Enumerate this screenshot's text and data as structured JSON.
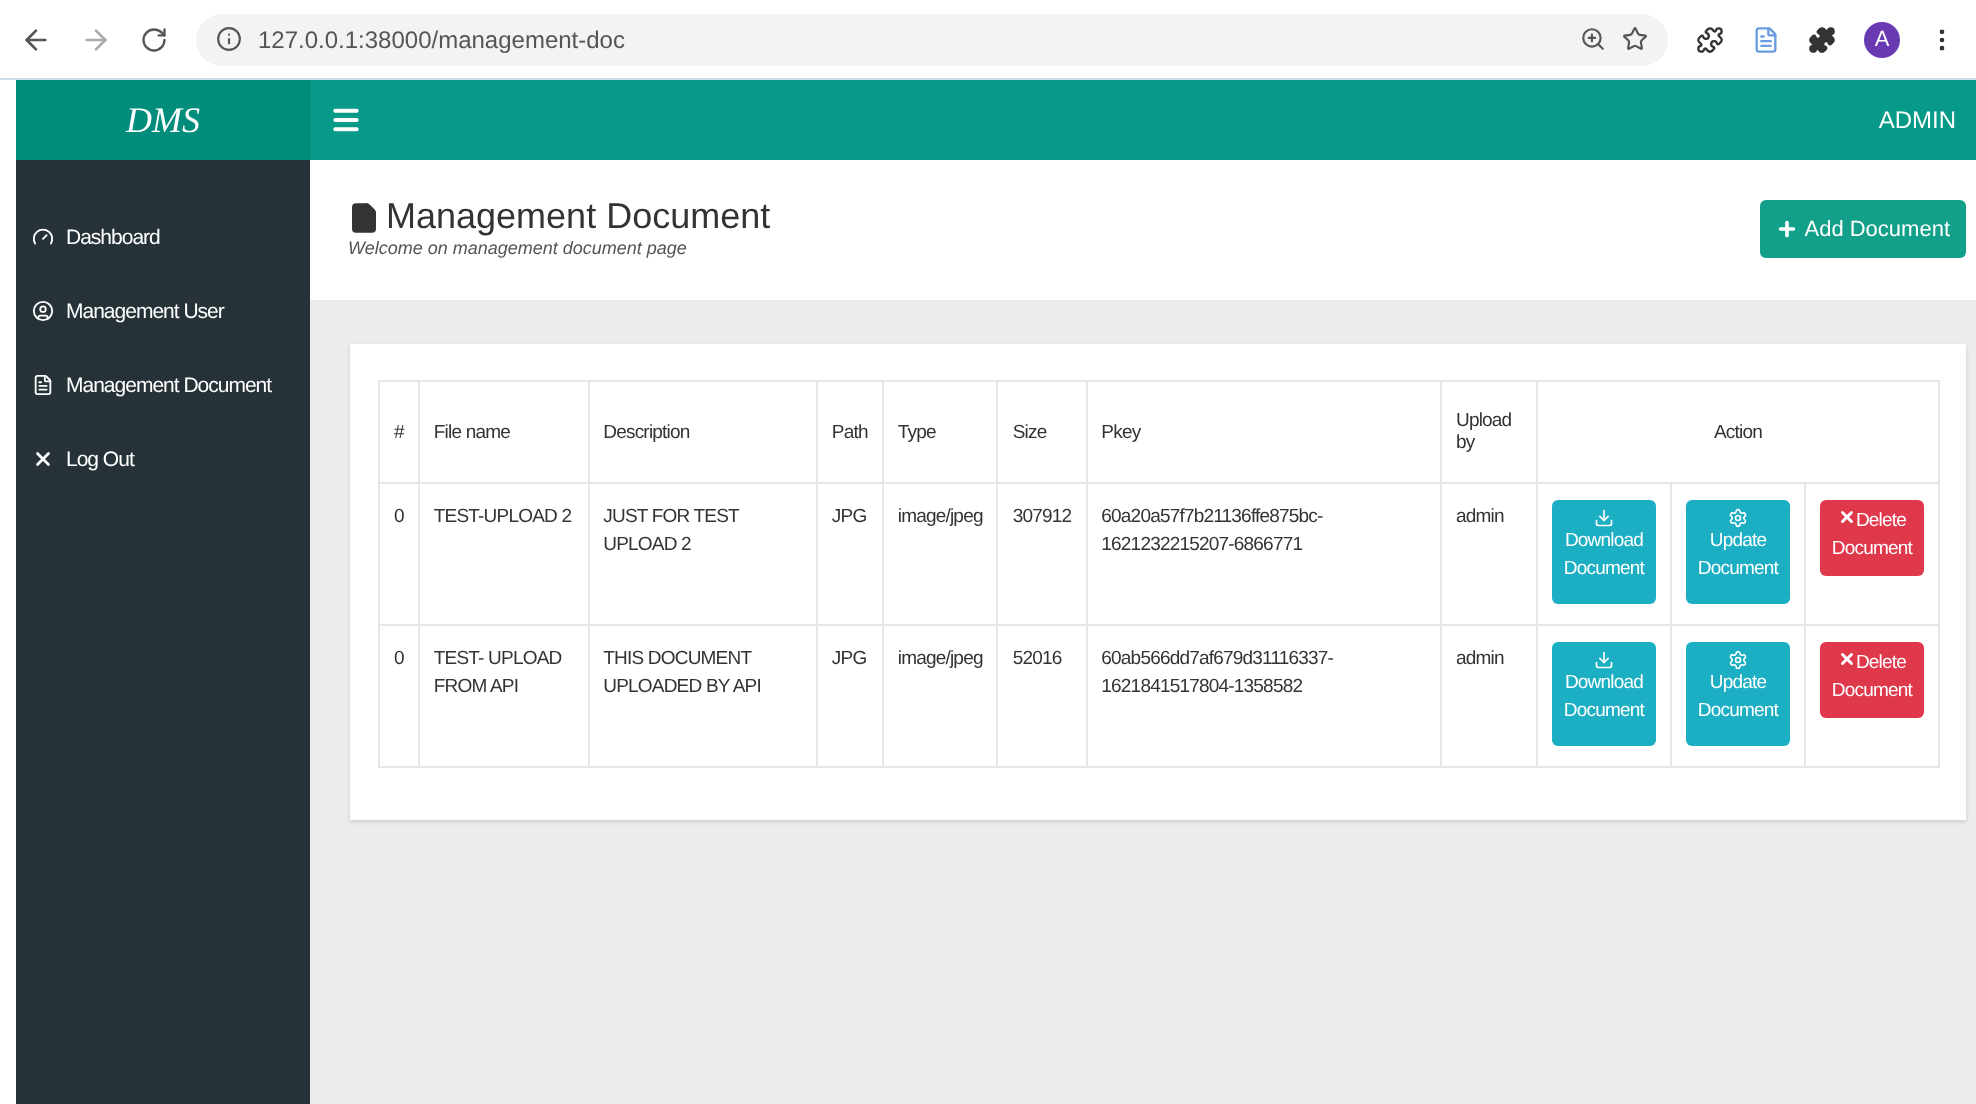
{
  "browser": {
    "url": "127.0.0.1:38000/management-doc",
    "profile_initial": "A"
  },
  "brand": "DMS",
  "topbar": {
    "user": "ADMIN"
  },
  "sidebar": {
    "items": [
      {
        "label": "Dashboard",
        "kind": "dashboard"
      },
      {
        "label": "Management User",
        "kind": "user"
      },
      {
        "label": "Management Document",
        "kind": "document"
      },
      {
        "label": "Log Out",
        "kind": "logout"
      }
    ]
  },
  "page": {
    "title": "Management Document",
    "subtitle": "Welcome on management document page",
    "add_button": "Add Document"
  },
  "table": {
    "columns": [
      "#",
      "File name",
      "Description",
      "Path",
      "Type",
      "Size",
      "Pkey",
      "Upload by",
      "Action"
    ],
    "rows": [
      {
        "cells": [
          "0",
          "TEST-UPLOAD 2",
          "JUST FOR TEST UPLOAD 2",
          "JPG",
          "image/jpeg",
          "307912",
          "60a20a57f7b21136ffe875bc-1621232215207-6866771",
          "admin"
        ],
        "actions": [
          {
            "kind": "download",
            "label": "Download Document"
          },
          {
            "kind": "update",
            "label": "Update Document"
          },
          {
            "kind": "delete",
            "label": "Delete Document"
          }
        ]
      },
      {
        "cells": [
          "0",
          "TEST- UPLOAD FROM API",
          "THIS DOCUMENT UPLOADED BY API",
          "JPG",
          "image/jpeg",
          "52016",
          "60ab566dd7af679d31116337-1621841517804-1358582",
          "admin"
        ],
        "actions": [
          {
            "kind": "download",
            "label": "Download Document"
          },
          {
            "kind": "update",
            "label": "Update Document"
          },
          {
            "kind": "delete",
            "label": "Delete Document"
          }
        ]
      }
    ]
  }
}
